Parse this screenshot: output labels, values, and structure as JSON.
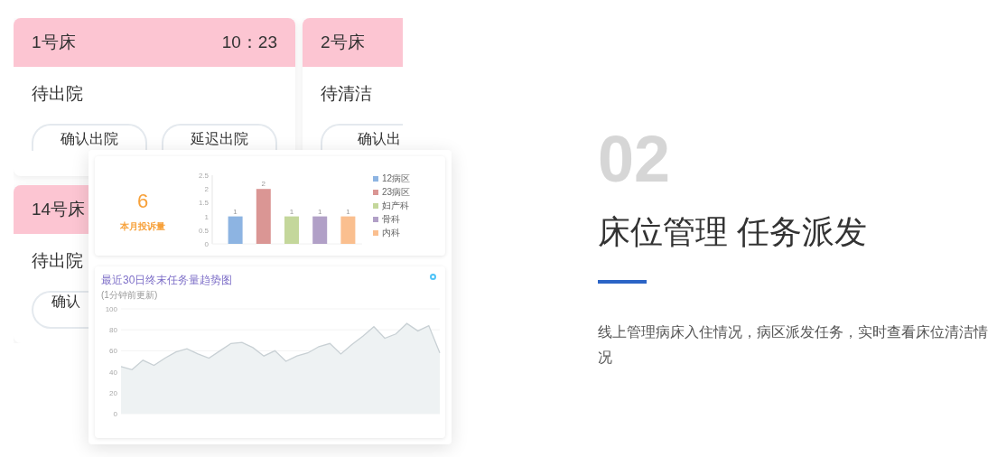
{
  "beds": [
    {
      "bed": "1号床",
      "time": "10：23",
      "status": "待出院",
      "actions": [
        "确认出院",
        "延迟出院"
      ]
    },
    {
      "bed": "2号床",
      "status": "待清洁",
      "actions": [
        "确认出"
      ]
    },
    {
      "bed": "14号床",
      "status": "待出院",
      "actions": [
        "确认"
      ]
    }
  ],
  "dashboard": {
    "complaints": {
      "value": "6",
      "label": "本月投诉量"
    },
    "bar_chart": {
      "chart_data": {
        "type": "bar",
        "ylim": [
          0,
          2.5
        ],
        "yticks": [
          0,
          {
            "value": 0.5,
            "label": "0.5"
          },
          1,
          {
            "value": 1.5,
            "label": "1.5"
          },
          2,
          {
            "value": 2.5,
            "label": "2.5"
          }
        ],
        "data_labels": true,
        "legend": "right",
        "series": [
          {
            "name": "12病区",
            "color": "#8db4e2",
            "values": [
              1
            ]
          },
          {
            "name": "23病区",
            "color": "#da9694",
            "values": [
              2
            ]
          },
          {
            "name": "妇产科",
            "color": "#c4d79b",
            "values": [
              1
            ]
          },
          {
            "name": "骨科",
            "color": "#b1a0c7",
            "values": [
              1
            ]
          },
          {
            "name": "内科",
            "color": "#fabf8f",
            "values": [
              1
            ]
          }
        ]
      }
    },
    "trend": {
      "title": "最近30日终末任务量趋势图",
      "subtitle": "(1分钟前更新)",
      "chart_data": {
        "type": "area",
        "ylim": [
          0,
          100
        ],
        "yticks": [
          0,
          20,
          40,
          60,
          80,
          100
        ],
        "series": [
          {
            "color": "#c8d0d4",
            "values": [
              45,
              42,
              51,
              46,
              53,
              59,
              62,
              57,
              53,
              60,
              67,
              68,
              63,
              55,
              60,
              50,
              55,
              58,
              64,
              67,
              57,
              66,
              74,
              83,
              72,
              76,
              86,
              79,
              84,
              58
            ]
          }
        ]
      }
    }
  },
  "feature": {
    "number": "02",
    "title": "床位管理 任务派发",
    "description": "线上管理病床入住情况，病区派发任务，实时查看床位清洁情况"
  }
}
